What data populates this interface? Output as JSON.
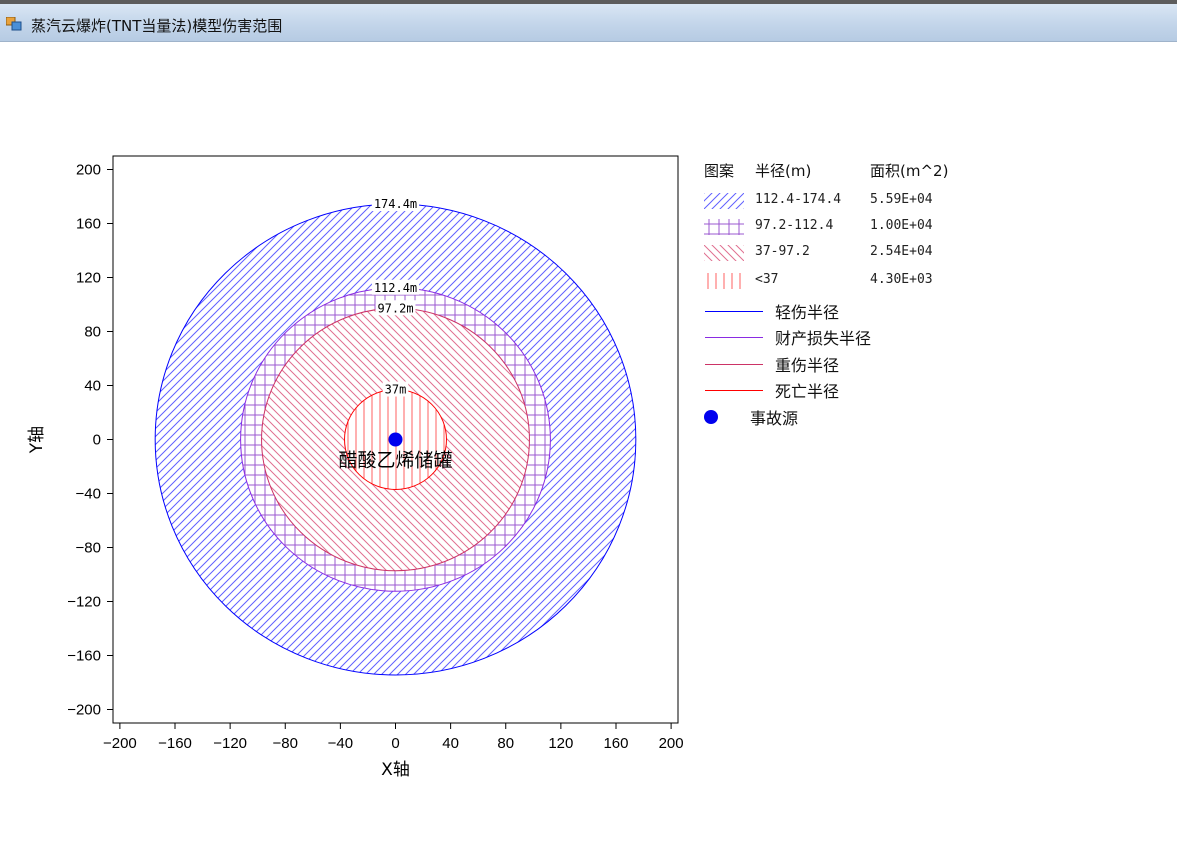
{
  "window": {
    "title": "蒸汽云爆炸(TNT当量法)模型伤害范围"
  },
  "legend": {
    "header": {
      "pattern": "图案",
      "radius": "半径(m)",
      "area": "面积(m^2)"
    },
    "zones": [
      {
        "pattern": "forward-diagonal-hatch",
        "color": "#3c3cff",
        "range": "112.4-174.4",
        "area": "5.59E+04"
      },
      {
        "pattern": "grid-hatch",
        "color": "#8a2be2",
        "range": "97.2-112.4",
        "area": "1.00E+04"
      },
      {
        "pattern": "backward-diagonal-hatch",
        "color": "#e0608a",
        "range": "37-97.2",
        "area": "2.54E+04"
      },
      {
        "pattern": "vertical-hatch",
        "color": "#ff3030",
        "range": "<37",
        "area": "4.30E+03"
      }
    ],
    "lines": [
      {
        "label": "轻伤半径",
        "color": "#0000ff"
      },
      {
        "label": "财产损失半径",
        "color": "#8a2be2"
      },
      {
        "label": "重伤半径",
        "color": "#cc3366"
      },
      {
        "label": "死亡半径",
        "color": "#ff0000"
      }
    ],
    "source": {
      "label": "事故源",
      "color": "#0000ee"
    }
  },
  "chart_data": {
    "type": "scatter",
    "xlabel": "X轴",
    "ylabel": "Y轴",
    "xlim": [
      -205,
      205
    ],
    "ylim": [
      -210,
      210
    ],
    "xticks": [
      -200,
      -160,
      -120,
      -80,
      -40,
      0,
      40,
      80,
      120,
      160,
      200
    ],
    "yticks": [
      200,
      160,
      120,
      80,
      40,
      0,
      -40,
      -80,
      -120,
      -160,
      -200
    ],
    "tick_labels_x": [
      "-200",
      "-160",
      "-120",
      "-80",
      "-40",
      "0",
      "40",
      "80",
      "120",
      "160",
      "200"
    ],
    "tick_labels_y": [
      "200",
      "160",
      "120",
      "80",
      "40",
      "0",
      "-40",
      "-80",
      "-120",
      "-160",
      "-200"
    ],
    "grid": false,
    "circles": [
      {
        "radius": 174.4,
        "label": "174.4m",
        "stroke": "#0000ff",
        "hatch": "forward-diagonal",
        "hatch_color": "#6060ff"
      },
      {
        "radius": 112.4,
        "label": "112.4m",
        "stroke": "#8a2be2",
        "hatch": "grid",
        "hatch_color": "#9b59d0"
      },
      {
        "radius": 97.2,
        "label": "97.2m",
        "stroke": "#cc3366",
        "hatch": "backward-diagonal",
        "hatch_color": "#e07090"
      },
      {
        "radius": 37,
        "label": "37m",
        "stroke": "#ff0000",
        "hatch": "vertical",
        "hatch_color": "#ff6060"
      }
    ],
    "source": {
      "x": 0,
      "y": 0,
      "label": "醋酸乙烯储罐",
      "color": "#0000ee"
    }
  }
}
